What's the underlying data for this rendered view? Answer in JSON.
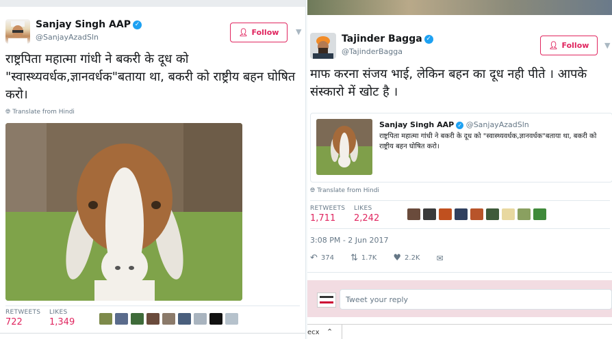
{
  "left_tweet": {
    "author": {
      "name": "Sanjay Singh AAP",
      "handle": "@SanjayAzadSln"
    },
    "follow_label": "Follow",
    "text": "राष्ट्रपिता महात्मा गांधी ने बकरी के दूध को \"स्वास्थ्यवर्धक,ज्ञानवर्धक\"बताया था, बकरी को राष्ट्रीय बहन घोषित करो।",
    "translate_label": "Translate from Hindi",
    "stats": {
      "retweets_label": "RETWEETS",
      "retweets": "722",
      "likes_label": "LIKES",
      "likes": "1,349"
    }
  },
  "right_tweet": {
    "author": {
      "name": "Tajinder Bagga",
      "handle": "@TajinderBagga"
    },
    "follow_label": "Follow",
    "text": "माफ करना संजय भाई, लेकिन बहन का दूध नही पीते । आपके संस्कारो में खोट है ।",
    "quoted": {
      "name": "Sanjay Singh AAP",
      "handle": "@SanjayAzadSln",
      "text": "राष्ट्रपिता महात्मा गांधी ने बकरी के दूध को \"स्वास्थ्यवर्धक,ज्ञानवर्धक\"बताया था, बकरी को राष्ट्रीय बहन घोषित करो।"
    },
    "translate_label": "Translate from Hindi",
    "stats": {
      "retweets_label": "RETWEETS",
      "retweets": "1,711",
      "likes_label": "LIKES",
      "likes": "2,242"
    },
    "timestamp": "3:08 PM - 2 Jun 2017",
    "actions": {
      "reply_count": "374",
      "retweet_count": "1.7K",
      "like_count": "2.2K"
    },
    "reply_placeholder": "Tweet your reply"
  },
  "colors": {
    "accent": "#e0245e",
    "verified": "#1da1f2",
    "muted": "#657786"
  }
}
